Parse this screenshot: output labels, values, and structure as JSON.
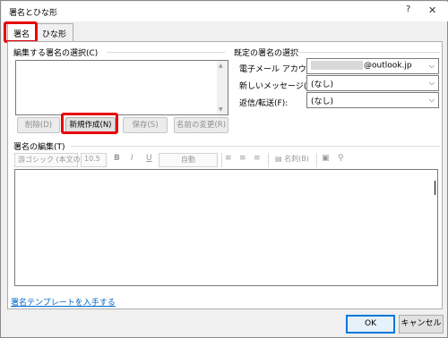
{
  "window": {
    "title": "署名とひな形",
    "help": "?",
    "close": "✕"
  },
  "tabs": [
    {
      "label": "署名"
    },
    {
      "label": "ひな形"
    }
  ],
  "signature_select": {
    "label": "編集する署名の選択(C)"
  },
  "buttons": {
    "delete": "削除(D)",
    "new": "新規作成(N)",
    "save": "保存(S)",
    "rename": "名前の変更(R)"
  },
  "defaults": {
    "header": "既定の署名の選択",
    "account_label": "電子メール アカウント(A):",
    "account_value": "@outlook.jp",
    "new_msg_label": "新しいメッセージ(M):",
    "new_msg_value": "(なし)",
    "reply_label": "返信/転送(F):",
    "reply_value": "(なし)"
  },
  "edit": {
    "label": "署名の編集(T)",
    "font": "游ゴシック (本文の",
    "size": "10.5",
    "bold": "B",
    "italic": "I",
    "underline": "U",
    "color": "自動",
    "business_card": "名刺(B)"
  },
  "footer": {
    "link": "署名テンプレートを入手する",
    "ok": "OK",
    "cancel": "キャンセル"
  }
}
